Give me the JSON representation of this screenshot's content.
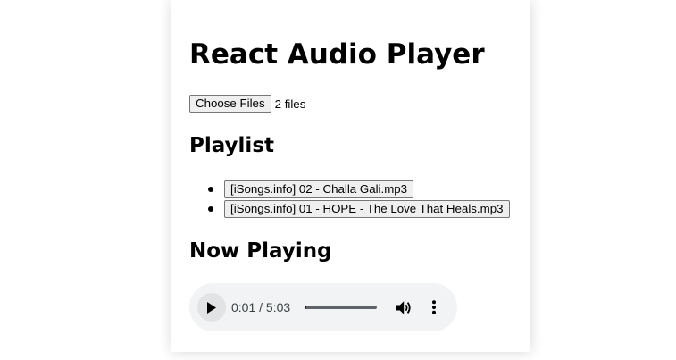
{
  "app": {
    "title": "React Audio Player"
  },
  "file_input": {
    "button_label": "Choose Files",
    "status": "2 files"
  },
  "playlist": {
    "heading": "Playlist",
    "tracks": [
      {
        "label": "[iSongs.info] 02 - Challa Gali.mp3"
      },
      {
        "label": "[iSongs.info] 01 - HOPE - The Love That Heals.mp3"
      }
    ]
  },
  "now_playing": {
    "heading": "Now Playing",
    "player": {
      "time_display": "0:01 / 5:03",
      "progress_fraction": 0.003,
      "icons": {
        "play": "play-icon",
        "volume": "volume-icon",
        "more": "more-vert-icon"
      }
    }
  },
  "colors": {
    "player_background": "#f1f3f4",
    "button_background": "#efefef",
    "button_border": "#767676",
    "card_shadow": "rgba(0,0,0,0.16)"
  }
}
